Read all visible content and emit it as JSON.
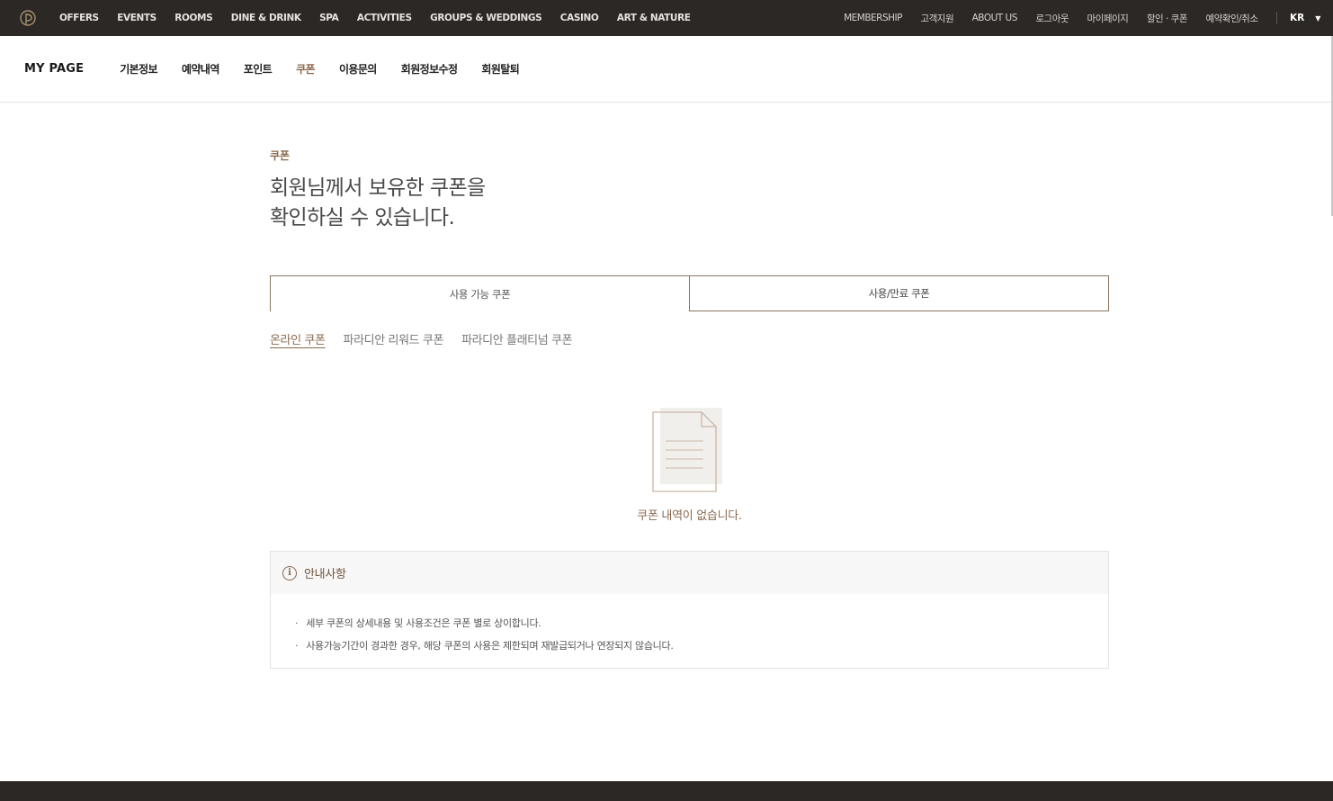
{
  "topbar": {
    "logo": "paradise-logo",
    "nav": [
      "OFFERS",
      "EVENTS",
      "ROOMS",
      "DINE & DRINK",
      "SPA",
      "ACTIVITIES",
      "GROUPS & WEDDINGS",
      "CASINO",
      "ART & NATURE"
    ],
    "util": [
      "MEMBERSHIP",
      "고객지원",
      "ABOUT US",
      "로그아웃",
      "마이페이지",
      "할인 · 쿠폰",
      "예약확인/취소"
    ],
    "lang": "KR"
  },
  "subnav": {
    "title": "MY PAGE",
    "items": [
      "기본정보",
      "예약내역",
      "포인트",
      "쿠폰",
      "이용문의",
      "회원정보수정",
      "회원탈퇴"
    ],
    "active": "쿠폰"
  },
  "main": {
    "section_label": "쿠폰",
    "headline": "회원님께서 보유한 쿠폰을\n확인하실 수 있습니다.",
    "tabs": [
      "사용 가능 쿠폰",
      "사용/만료 쿠폰"
    ],
    "subtabs": [
      "온라인 쿠폰",
      "파라디안 리워드 쿠폰",
      "파라디안 플래티넘 쿠폰"
    ],
    "empty_text": "쿠폰 내역이 없습니다.",
    "notice": {
      "title": "안내사항",
      "lines": [
        "세부 쿠폰의 상세내용 및 사용조건은 쿠폰 별로 상이합니다.",
        "사용가능기간이 경과한 경우, 해당 쿠폰의 사용은 제한되며 재발급되거나 연장되지 않습니다."
      ]
    }
  },
  "colors": {
    "topbar_bg": "#2b2825",
    "accent": "#8a6a4f",
    "border": "#8a7560"
  }
}
